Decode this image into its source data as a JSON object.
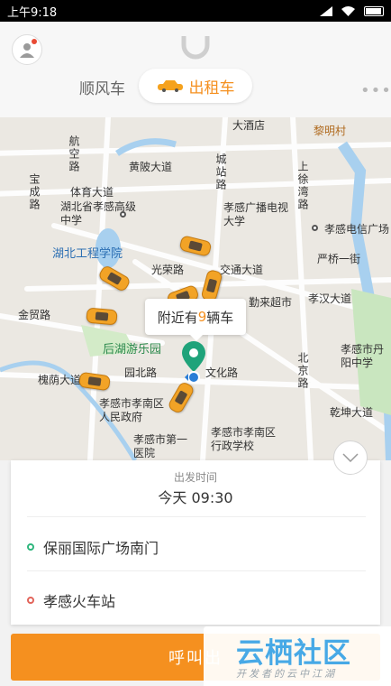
{
  "status_bar": {
    "time": "上午9:18"
  },
  "header": {
    "tabs": {
      "shunfeng": "顺风车",
      "taxi": "出租车"
    },
    "more": "•••"
  },
  "map": {
    "labels": [
      "大酒店",
      "黎明村",
      "航空路",
      "黄陂大道",
      "城站路",
      "上徐湾路",
      "宝成路",
      "体育大道",
      "湖北省孝感高级中学",
      "孝感广播电视大学",
      "孝感电信广场",
      "湖北工程学院",
      "严桥一街",
      "光荣路",
      "交通大道",
      "勤来超市",
      "孝汉大道",
      "金贸路",
      "后湖游乐园",
      "孝感市丹阳中学",
      "园北路",
      "文化路",
      "北京路",
      "槐荫大道",
      "乾坤大道",
      "孝感市孝南区人民政府",
      "孝感市孝南区行政学校",
      "孝感市第一医院"
    ],
    "nearby_prefix": "附近有",
    "nearby_count": "9",
    "nearby_suffix": "辆车"
  },
  "panel": {
    "time_label": "出发时间",
    "time_value": "今天 09:30",
    "from": "保丽国际广场南门",
    "to": "孝感火车站"
  },
  "call_button": "呼叫出",
  "watermark": {
    "title": "云栖社区",
    "subtitle": "开发者的云中江湖"
  },
  "colors": {
    "accent": "#f5901f",
    "pin": "#1fa37a",
    "watermark": "#47a9e6"
  }
}
